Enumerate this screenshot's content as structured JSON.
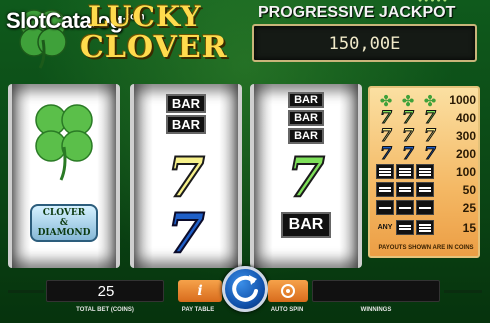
{
  "watermark": {
    "name": "SlotCatalog",
    "domain": ".com"
  },
  "game": {
    "title_line1": "LUCKY",
    "title_line2": "CLOVER"
  },
  "jackpot": {
    "label": "PROGRESSIVE JACKPOT",
    "value": "150,00E"
  },
  "reels": {
    "reel1": {
      "middle_icon": "four-leaf-clover-icon",
      "bottom_badge_line1": "CLOVER",
      "bottom_badge_line2": "&",
      "bottom_badge_line3": "DIAMOND"
    },
    "reel2": {
      "top_bar_1": "BAR",
      "top_bar_2": "BAR",
      "middle": "7",
      "bottom": "7"
    },
    "reel3": {
      "top_bar_1": "BAR",
      "top_bar_2": "BAR",
      "top_bar_3": "BAR",
      "middle": "7",
      "bottom": "BAR"
    }
  },
  "paytable": {
    "rows": [
      {
        "combo": "3 clovers",
        "value": "1000"
      },
      {
        "combo": "3 green sevens",
        "value": "400"
      },
      {
        "combo": "3 yellow sevens",
        "value": "300"
      },
      {
        "combo": "3 blue sevens",
        "value": "200"
      },
      {
        "combo": "3 triple bars",
        "value": "100"
      },
      {
        "combo": "3 double bars",
        "value": "50"
      },
      {
        "combo": "3 single bars",
        "value": "25"
      },
      {
        "combo_label": "ANY",
        "combo": "any bars",
        "value": "15"
      }
    ],
    "note": "PAYOUTS SHOWN ARE IN COINS"
  },
  "controls": {
    "bet_value": "25",
    "bet_label": "TOTAL BET (COINS)",
    "paytable_label": "PAY TABLE",
    "paytable_button": "i",
    "autospin_label": "AUTO SPIN",
    "winnings_label": "WINNINGS",
    "winnings_value": ""
  },
  "colors": {
    "background": "#0b4715",
    "title_gold": "#ffdb4d",
    "accent_orange": "#e07a26",
    "spin_blue": "#1f5fc8"
  }
}
